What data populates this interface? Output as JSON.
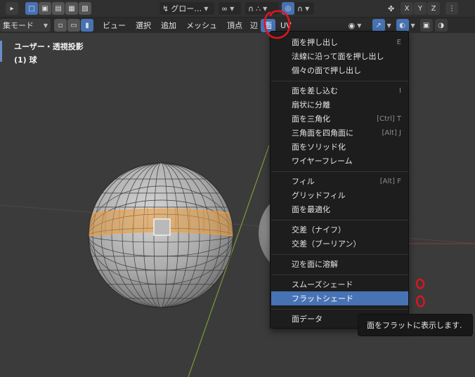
{
  "toolbar1": {
    "transform_orientation": "グロー…",
    "axes": [
      "X",
      "Y",
      "Z"
    ]
  },
  "toolbar2": {
    "mode": "集モード",
    "menus": [
      "ビュー",
      "選択",
      "追加",
      "メッシュ",
      "頂点",
      "辺",
      "面",
      "UV"
    ],
    "active_menu": "面"
  },
  "viewport": {
    "view_label": "ユーザー・透視投影",
    "object_label": "(1) 球"
  },
  "face_menu": {
    "items": [
      {
        "label": "面を押し出し",
        "shortcut": "E"
      },
      {
        "label": "法線に沿って面を押し出し",
        "shortcut": ""
      },
      {
        "label": "個々の面で押し出し",
        "shortcut": ""
      },
      {
        "label": "面を差し込む",
        "shortcut": "I"
      },
      {
        "label": "扇状に分離",
        "shortcut": ""
      },
      {
        "label": "面を三角化",
        "shortcut": "[Ctrl] T"
      },
      {
        "label": "三角面を四角面に",
        "shortcut": "[Alt] J"
      },
      {
        "label": "面をソリッド化",
        "shortcut": ""
      },
      {
        "label": "ワイヤーフレーム",
        "shortcut": ""
      },
      {
        "label": "フィル",
        "shortcut": "[Alt] F"
      },
      {
        "label": "グリッドフィル",
        "shortcut": ""
      },
      {
        "label": "面を最適化",
        "shortcut": ""
      },
      {
        "label": "交差（ナイフ）",
        "shortcut": ""
      },
      {
        "label": "交差（ブーリアン）",
        "shortcut": ""
      },
      {
        "label": "辺を面に溶解",
        "shortcut": ""
      },
      {
        "label": "スムーズシェード",
        "shortcut": ""
      },
      {
        "label": "フラットシェード",
        "shortcut": ""
      },
      {
        "label": "面データ",
        "shortcut": ""
      }
    ],
    "highlighted": "フラットシェード"
  },
  "tooltip": {
    "text": "面をフラットに表示します."
  },
  "colors": {
    "accent": "#4772b3",
    "selection": "#e89a3c",
    "annotation": "#e0141e"
  }
}
